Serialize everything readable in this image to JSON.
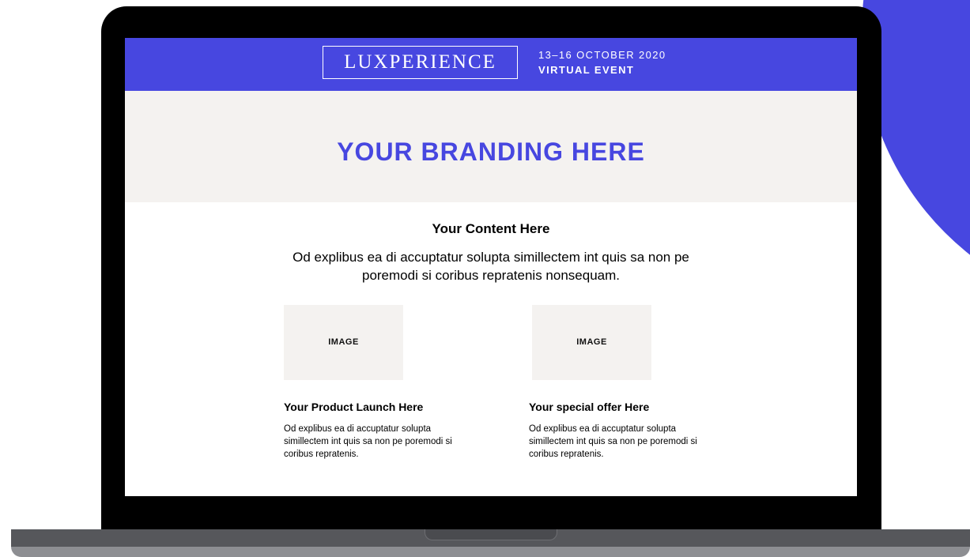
{
  "header": {
    "logo": "LUXPERIENCE",
    "event_date": "13–16 OCTOBER 2020",
    "event_type": "VIRTUAL EVENT"
  },
  "branding": {
    "text": "YOUR BRANDING HERE"
  },
  "content": {
    "title": "Your Content Here",
    "body": "Od explibus ea di accuptatur solupta simillectem int quis sa non pe poremodi si coribus repratenis nonsequam."
  },
  "cards": [
    {
      "image_label": "IMAGE",
      "title": "Your Product Launch Here",
      "body": "Od explibus ea di accuptatur solupta simillectem int quis sa non pe poremodi si coribus repratenis."
    },
    {
      "image_label": "IMAGE",
      "title": "Your special offer Here",
      "body": "Od explibus ea di accuptatur solupta simillectem int quis sa non pe poremodi si coribus repratenis."
    }
  ],
  "colors": {
    "accent": "#4747e0",
    "band_background": "#f4f2f0",
    "bezel": "#000000"
  }
}
